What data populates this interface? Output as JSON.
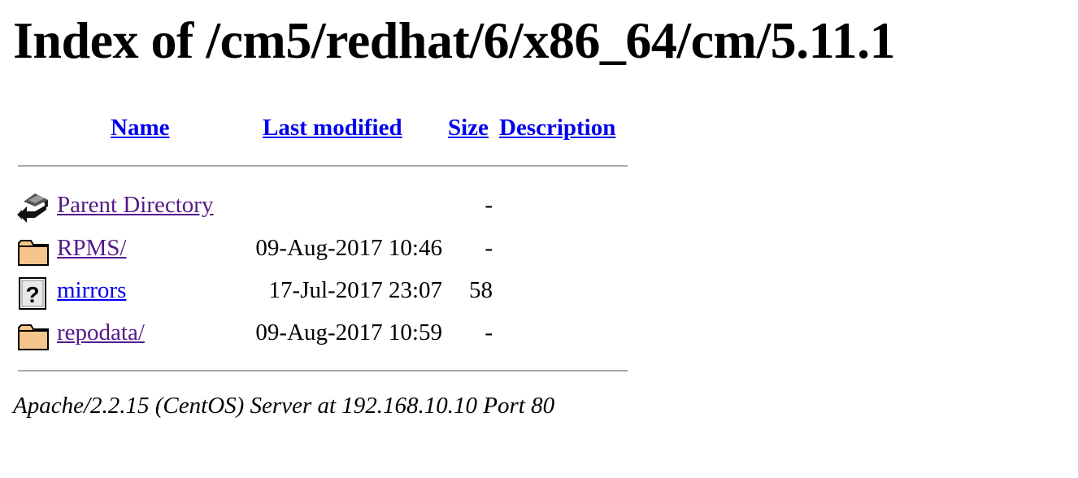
{
  "page_title": "Index of /cm5/redhat/6/x86_64/cm/5.11.1",
  "columns": {
    "name": "Name",
    "last_modified": "Last modified",
    "size": "Size",
    "description": "Description"
  },
  "entries": [
    {
      "icon": "back-icon",
      "name": "Parent Directory",
      "date": "",
      "size": "-",
      "description": ""
    },
    {
      "icon": "folder-icon",
      "name": "RPMS/",
      "date": "09-Aug-2017 10:46",
      "size": "-",
      "description": ""
    },
    {
      "icon": "unknown-file-icon",
      "name": "mirrors",
      "date": "17-Jul-2017 23:07",
      "size": "58",
      "description": ""
    },
    {
      "icon": "folder-icon",
      "name": "repodata/",
      "date": "09-Aug-2017 10:59",
      "size": "-",
      "description": ""
    }
  ],
  "footer": "Apache/2.2.15 (CentOS) Server at 192.168.10.10 Port 80",
  "colors": {
    "link": "#0000ee",
    "visited": "#551a8b",
    "rule": "#a8a8a8",
    "folder": "#f5c58c"
  }
}
